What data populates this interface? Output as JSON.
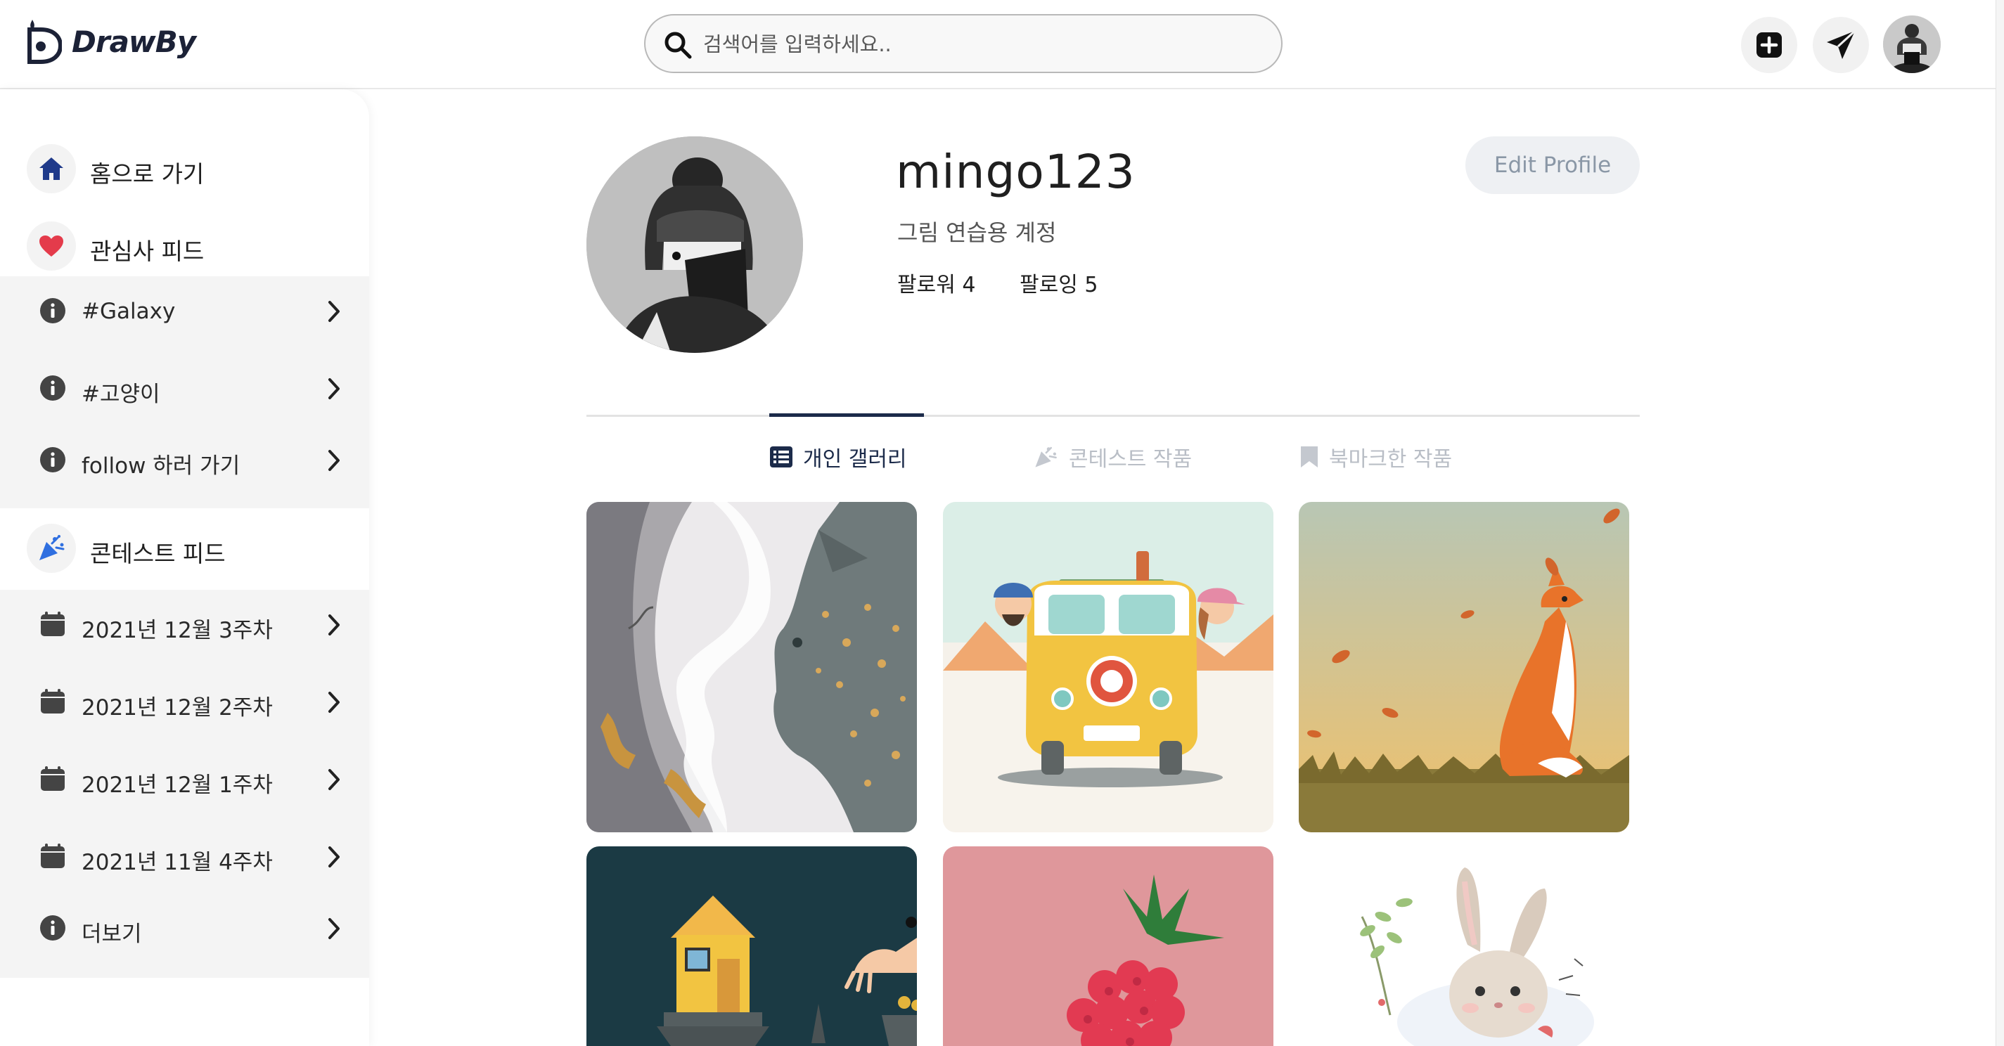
{
  "app": {
    "name": "DrawBy"
  },
  "search": {
    "placeholder": "검색어를 입력하세요.."
  },
  "header": {
    "icons": [
      "add-post-icon",
      "send-icon",
      "profile-avatar"
    ],
    "accent": "#1c2237"
  },
  "sidebar": {
    "home_label": "홈으로 가기",
    "interest_label": "관심사 피드",
    "interest_items": [
      {
        "label": "#Galaxy",
        "icon": "info-icon"
      },
      {
        "label": "#고양이",
        "icon": "info-icon"
      },
      {
        "label": "follow 하러 가기",
        "icon": "info-icon"
      }
    ],
    "contest_label": "콘테스트 피드",
    "contest_items": [
      {
        "label": "2021년 12월 3주차",
        "icon": "calendar-icon"
      },
      {
        "label": "2021년 12월 2주차",
        "icon": "calendar-icon"
      },
      {
        "label": "2021년 12월 1주차",
        "icon": "calendar-icon"
      },
      {
        "label": "2021년 11월 4주차",
        "icon": "calendar-icon"
      },
      {
        "label": "더보기",
        "icon": "info-icon"
      }
    ]
  },
  "profile": {
    "username": "mingo123",
    "bio": "그림 연습용 계정",
    "followers_label": "팔로워 4",
    "following_label": "팔로잉 5",
    "edit_label": "Edit Profile"
  },
  "tabs": {
    "active": "개인 갤러리",
    "items": [
      "개인 갤러리",
      "콘테스트 작품",
      "북마크한 작품"
    ]
  },
  "gallery": {
    "items": [
      "girl-and-leopard-artwork",
      "van-travel-artwork",
      "fox-autumn-artwork",
      "house-night-artwork",
      "raspberry-artwork",
      "bunny-artwork"
    ]
  }
}
